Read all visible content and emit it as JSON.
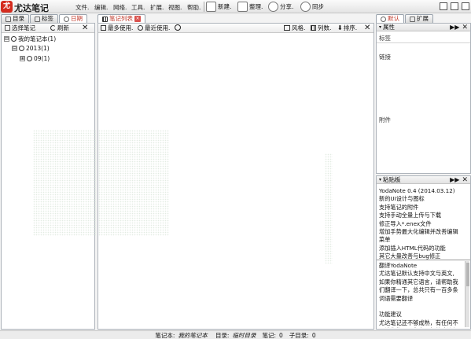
{
  "app": {
    "title": "尤达笔记",
    "logo_text": "尤"
  },
  "menu": [
    "文件.",
    "编辑.",
    "网络.",
    "工具.",
    "扩展.",
    "视图.",
    "帮助."
  ],
  "toolbar": {
    "new_label": "新建.",
    "organize_label": "整理.",
    "share_label": "分享.",
    "sync_label": "同步"
  },
  "left_panel": {
    "tabs": [
      "目录",
      "标签",
      "日期"
    ],
    "select_notebook": "选择笔记",
    "refresh": "刷新",
    "close": "✕",
    "tree": [
      {
        "label": "我的笔记本(1)",
        "expander": "⊟"
      },
      {
        "label": "2013(1)",
        "expander": "⊟"
      },
      {
        "label": "09(1)",
        "expander": "⊞"
      }
    ]
  },
  "center_panel": {
    "tab": "笔记列表",
    "most_used": "最多使用.",
    "recently_used": "最近使用.",
    "style": "风格.",
    "columns": "列数.",
    "sort": "排序.",
    "close": "✕"
  },
  "right_panel": {
    "tabs": [
      "默认",
      "扩展"
    ],
    "properties_title": "属性",
    "labels": {
      "tags": "标签",
      "links": "链接",
      "attachments": "附件"
    },
    "clipboard_title": "粘贴板",
    "clip1": "YodaNote 0.4 (2014.03.12)\n新的UI设计与图标\n支持笔记的附件\n支持手动全量上传与下载\n修正导入*.enex文件\n增加手势最大化编辑并改善编辑\n菜单\n添加插入HTML代码的功能\n其它大量改善与bug修正",
    "clip2": "翻译YodaNote\n尤达笔记默认支持中文与英文,\n如果你精通其它语言，请帮助我\n们翻译一下，总共只有一百多条\n词语需要翻译\n\n功能建议\n尤达笔记还不够成熟，有任何不\n足请你指正，你有更好的建议与\n想法..."
  },
  "statusbar": {
    "notebook_label": "笔记本:",
    "notebook_value": "我的笔记本",
    "dir_label": "目录:",
    "dir_value": "临时目录",
    "notes_label": "笔记:",
    "notes_value": "0",
    "subdir_label": "子目录:",
    "subdir_value": "0"
  }
}
